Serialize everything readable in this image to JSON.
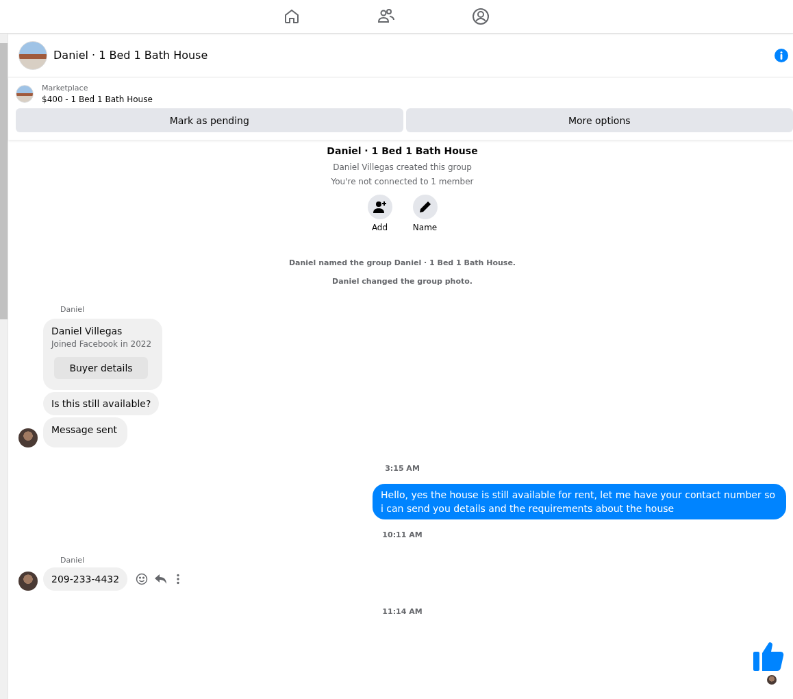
{
  "header": {
    "title": "Daniel · 1 Bed 1 Bath House"
  },
  "listing": {
    "source": "Marketplace",
    "title": "$400 - 1 Bed 1 Bath House"
  },
  "listing_actions": [
    "Mark as pending",
    "More options"
  ],
  "intro": {
    "title": "Daniel · 1 Bed 1 Bath House",
    "lines": [
      "Daniel Villegas created this group",
      "You're not connected to 1 member"
    ],
    "actions": [
      {
        "kind": "add",
        "label": "Add"
      },
      {
        "kind": "rename",
        "label": "Name"
      }
    ]
  },
  "timeline": [
    {
      "kind": "notice",
      "text": "Daniel named the group Daniel · 1 Bed 1 Bath House."
    },
    {
      "kind": "notice",
      "text": "Daniel changed the group photo."
    },
    {
      "kind": "sender",
      "text": "Daniel"
    },
    {
      "kind": "profile_card",
      "name": "Daniel Villegas",
      "detail": "Joined Facebook in 2022",
      "button": "Buyer details",
      "avatar": false
    },
    {
      "kind": "incoming",
      "text": "Is this still available?",
      "avatar": false,
      "tools": false
    },
    {
      "kind": "incoming",
      "text": "Message sent",
      "avatar": true,
      "tools": false
    },
    {
      "kind": "timestamp",
      "text": "3:15 AM"
    },
    {
      "kind": "outgoing",
      "text": "Hello, yes the house is still available for rent, let me have your contact number so i can send you details and the requirements about the house"
    },
    {
      "kind": "timestamp",
      "text": "10:11 AM"
    },
    {
      "kind": "sender",
      "text": "Daniel"
    },
    {
      "kind": "incoming",
      "text": "209-233-4432",
      "avatar": true,
      "tools": true
    },
    {
      "kind": "timestamp",
      "text": "11:14 AM"
    },
    {
      "kind": "like",
      "seen": true
    }
  ]
}
